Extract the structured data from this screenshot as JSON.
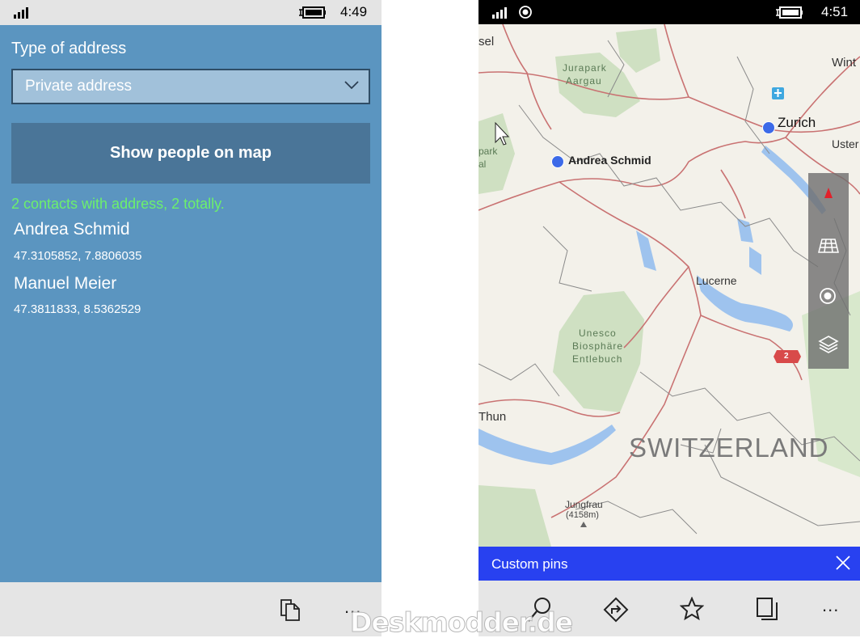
{
  "left_screen": {
    "status_bar": {
      "time": "4:49"
    },
    "address_type": {
      "label": "Type of address",
      "selected_value": "Private address"
    },
    "show_map_button": "Show people on map",
    "summary": "2 contacts with address, 2 totally.",
    "contacts": [
      {
        "name": "Andrea Schmid",
        "coords": "47.3105852, 7.8806035"
      },
      {
        "name": "Manuel Meier",
        "coords": "47.3811833, 8.5362529"
      }
    ],
    "app_bar": {
      "more": "..."
    }
  },
  "right_screen": {
    "status_bar": {
      "time": "4:51"
    },
    "map": {
      "labels": {
        "sel": "sel",
        "jurapark": "Jurapark",
        "aargau": "Aargau",
        "park": "park",
        "al": "al",
        "zurich": "Zurich",
        "winterthur_partial": "Wint",
        "uster_partial": "Uster",
        "andrea": "Andrea Schmid",
        "lucerne": "Lucerne",
        "unesco1": "Unesco",
        "unesco2": "Biosphäre",
        "unesco3": "Entlebuch",
        "thun": "Thun",
        "country": "SWITZERLAND",
        "jungfrau": "Jungfrau",
        "jungfrau_elev": "(4158m)",
        "road_shield": "2"
      }
    },
    "pin_bar": {
      "label": "Custom pins"
    },
    "app_bar": {
      "more": "..."
    }
  },
  "watermark": "Deskmodder.de",
  "colors": {
    "left_background": "#5b95c0",
    "button_background": "#4a7598",
    "summary_text": "#6cf06c",
    "pin_bar": "#2841f0",
    "map_pin": "#3c6ae8"
  }
}
